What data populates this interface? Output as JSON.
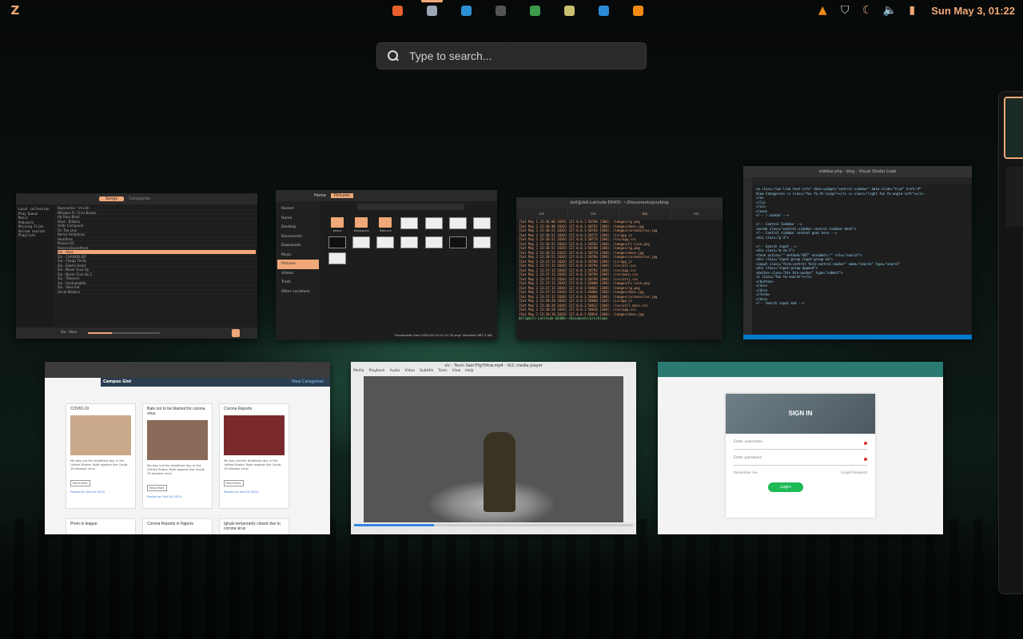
{
  "topbar": {
    "menu_icon": "zorin-menu-icon",
    "clock": "Sun May  3, 01:22",
    "dock": [
      {
        "name": "firefox",
        "color": "#e8602c",
        "active": false
      },
      {
        "name": "files",
        "color": "#9aa7b5",
        "active": true
      },
      {
        "name": "screenshot",
        "color": "#2d8fd6",
        "active": false
      },
      {
        "name": "terminal",
        "color": "#555555",
        "active": false
      },
      {
        "name": "chrome",
        "color": "#3c9b4a",
        "active": false
      },
      {
        "name": "rhythmbox",
        "color": "#c8c070",
        "active": false
      },
      {
        "name": "vscode",
        "color": "#2b8bd6",
        "active": false
      },
      {
        "name": "vlc",
        "color": "#f08a14",
        "active": false
      }
    ]
  },
  "search": {
    "placeholder": "Type to search..."
  },
  "windows": {
    "music": {
      "tab_active": "Songs",
      "tab_other": "Categories",
      "sidebar": [
        "Local collection",
        "Play Queue",
        "Music",
        "Podcasts",
        "Missing Files",
        "Online sources",
        "Playlists"
      ],
      "rows": [
        "Bassnectar - Vs Life",
        "Whiskey Ft. Chris Brown",
        "Ab Daru Bhari",
        "Alive - Billions",
        "Odds Compared",
        "On The Line",
        "Bernie Ambitious",
        "Heartless",
        "Phases RX",
        "ReserveSoundtrack",
        "Sia - Alive",
        "Sia - CHANDELIER",
        "Sia - Cheap Thrills",
        "Sia - Elastic Heart",
        "Sia - Never Give Up",
        "Sia - Never Give Up 2",
        "Sia - Titanium",
        "Sia - Unstoppable",
        "Sia - Alive Ext",
        "Uncle Wallace"
      ],
      "now_playing": "Sia - Alive"
    },
    "files": {
      "sidebar": [
        "Recent",
        "Home",
        "Desktop",
        "Documents",
        "Downloads",
        "Music",
        "Pictures",
        "Videos",
        "Trash",
        "Other Locations"
      ],
      "path_home": "Home",
      "path_current": "Pictures",
      "folders": [
        "phone",
        "Wallpapers",
        "Webcam"
      ],
      "status": "\"Screenshot from 2020-05-03 01-21-35.png\" selected (967.2 kB)"
    },
    "terminal": {
      "title": "dell@dell-Latitude-E6400: ~/Documents/pro/blog",
      "lines": [
        "[Sat May  2 23:36:08 2020] 127.0.0.1:50760 [200]: /images/ig.png",
        "[Sat May  2 23:36:08 2020] 127.0.0.1:50762 [200]: /images/doon.jpg",
        "[Sat May  2 23:36:51 2020] 127.0.0.1:50764 [200]: /images/coronavirus.jpg",
        "[Sat May  2 23:36:51 2020] 127.0.0.1:50772 [200]: /js/app.js",
        "[Sat May  2 23:36:51 2020] 127.0.0.1:50774 [200]: /css/app.css",
        "[Sat May  2 23:36:51 2020] 127.0.0.1:50782 [200]: /images/FL-Lion.png",
        "[Sat May  2 23:36:51 2020] 127.0.0.1:50780 [200]: /images/ig.png",
        "[Sat May  2 23:36:51 2020] 127.0.0.1:50778 [200]: /images/doon.jpg",
        "[Sat May  2 23:36:51 2020] 127.0.0.1:50784 [200]: /images/coronavirus.jpg",
        "[Sat May  2 23:37:15 2020] 127.0.0.1:50786 [200]: /js/app.js",
        "[Sat May  2 23:37:15 2020] 127.0.0.1:50794 [200]: /css/all.css",
        "[Sat May  2 23:37:15 2020] 127.0.0.1:50792 [200]: /css/app.css",
        "[Sat May  2 23:37:15 2020] 127.0.0.1:50798 [200]: /css/main.css",
        "[Sat May  2 23:37:15 2020] 127.0.0.1:50796 [200]: /css/util.css",
        "[Sat May  2 23:37:15 2020] 127.0.0.1:50800 [200]: /images/FL-Lion.png",
        "[Sat May  2 23:37:15 2020] 127.0.0.1:50802 [200]: /images/ig.png",
        "[Sat May  2 23:37:15 2020] 127.0.0.1:50804 [200]: /images/doon.jpg",
        "[Sat May  2 23:37:15 2020] 127.0.0.1:50806 [200]: /images/coronavirus.jpg",
        "[Sat May  2 23:38:20 2020] 127.0.0.1:50808 [200]: /js/app.js",
        "[Sat May  2 23:38:20 2020] 127.0.0.1:50812 [200]: /css/util.main.css",
        "[Sat May  2 23:38:20 2020] 127.0.0.1:50810 [200]: /css/app.css",
        "[Sat May  2 23:38:20 2020] 127.0.0.1:50814 [200]: /images/doon.jpg"
      ],
      "prompt": "dell@dell-Latitude-E6400:~/Documents/pro/blog$ "
    },
    "code": {
      "title": "sidebar.php - blog - Visual Studio Code",
      "lines": [
        "<a class=\"nav-link text-info\" data-widget=\"control-sidebar\" data-slide=\"true\" href=\"#\"",
        "  View Categories <i class=\"fas fa-th-large\"></i> <i class=\"right fas fa-angle-left\"></i>",
        "</a>",
        "</li>",
        "</ul>",
        "</nav>",
        "<!-- /.navbar -->",
        "",
        "<!-- Control Sidebar -->",
        "<aside class=\"control-sidebar control-sidebar-dark\">",
        "  <!-- Control sidebar content goes here -->",
        "  <div class=\"p-3\">",
        "",
        "    <!-- Search input -->",
        "    <div class=\"m-sb-3\">",
        "      <form action=\"\" method=\"GET\" onsubmit=\"\" role=\"search\">",
        "        <div class=\"input-group input-group-sm\">",
        "          <input class=\"form-control form-control-navbar\" name=\"search\" type=\"search\"",
        "          <div class=\"input-group-append\">",
        "            <button class=\"btn btn-navbar\" type=\"submit\">",
        "              <i class=\"fas fa-search\"></i>",
        "            </button>",
        "          </div>",
        "        </div>",
        "      </form>",
        "    </div>",
        "    <!-- Search input end -->"
      ]
    },
    "blog": {
      "brand": "Campus Gist",
      "view_categories": "View Categories",
      "cards": [
        {
          "title": "COVID-19",
          "text": "Mo day not the deadliest day in the United States' fight against the Covid-19 disease virus",
          "read": "Read More",
          "posted": "Posted on Sat 04-2020"
        },
        {
          "title": "Bats not to be blamed for corona virus",
          "text": "Mo day not the deadliest day in the United States' fight against the Covid-19 disease virus",
          "read": "Read More",
          "posted": "Posted on Sat 04-2020"
        },
        {
          "title": "Corona Reports",
          "text": "Mo day not the deadliest day in the United States' fight against the Covid-19 disease virus",
          "read": "Read More",
          "posted": "Posted on Sat 04-2020"
        }
      ],
      "bottom_titles": [
        "Prem in league",
        "Corona Reports in Nigeria",
        "Ighalo temporarily closed due to corona virus"
      ]
    },
    "video": {
      "title": "vlc - Tevin Sain?Hg?hfcw.mp4 - VLC media player",
      "menus": [
        "Media",
        "Playback",
        "Audio",
        "Video",
        "Subtitle",
        "Tools",
        "View",
        "Help"
      ]
    },
    "signin": {
      "heading": "SIGN IN",
      "username": "Enter username",
      "password": "Enter password",
      "remember": "Remember me",
      "forgot": "Forgot Password",
      "login": "Login"
    }
  }
}
